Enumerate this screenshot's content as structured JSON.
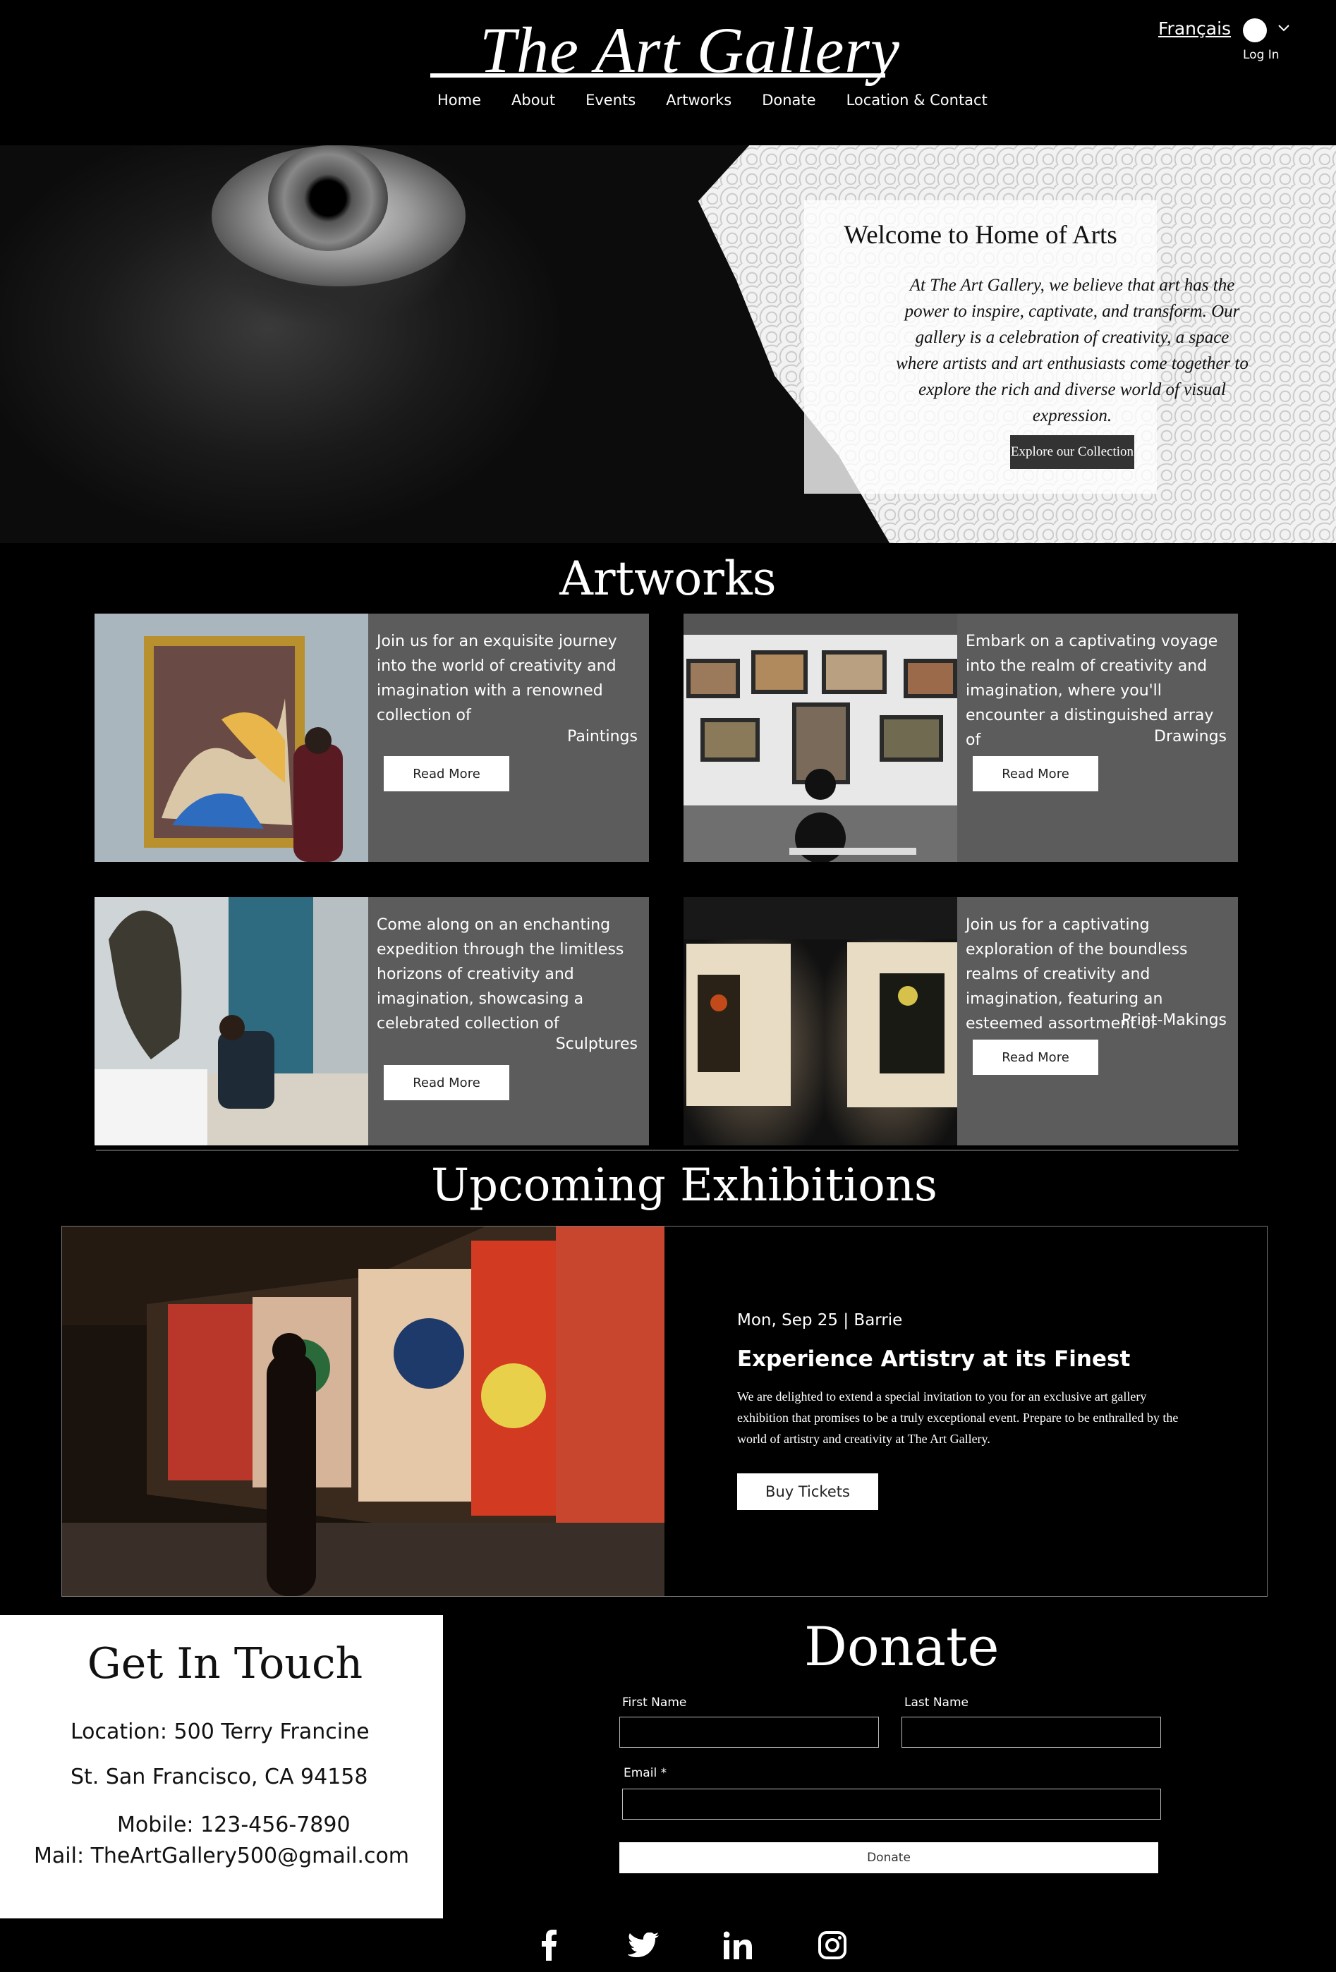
{
  "header": {
    "site_title": "The Art Gallery",
    "nav": [
      "Home",
      "About",
      "Events",
      "Artworks",
      "Donate",
      "Location & Contact"
    ],
    "language_link": "Français",
    "login_label": "Log In"
  },
  "hero": {
    "heading": "Welcome to Home of Arts",
    "text": "At The Art Gallery, we believe that art has the power to inspire, captivate, and transform. Our gallery is a celebration of creativity, a space where artists and art enthusiasts come together to explore the rich and diverse world of visual expression.",
    "cta_label": "Explore our Collection"
  },
  "artworks": {
    "heading": "Artworks",
    "cards": [
      {
        "text": "Join us for an exquisite journey into the world of creativity and imagination with a renowned collection of",
        "category": "Paintings",
        "button_label": "Read More"
      },
      {
        "text": "Embark on a captivating voyage into the realm of creativity and imagination, where you'll encounter a distinguished array of",
        "category": "Drawings",
        "button_label": "Read More"
      },
      {
        "text": "Come along on an enchanting expedition through the limitless horizons of creativity and imagination, showcasing a celebrated collection of",
        "category": "Sculptures",
        "button_label": "Read More"
      },
      {
        "text": "Join us for a captivating exploration of the boundless realms of creativity and imagination, featuring an esteemed assortment of",
        "category": "Print-Makings",
        "button_label": "Read More"
      }
    ]
  },
  "exhibitions": {
    "heading": "Upcoming Exhibitions",
    "event": {
      "date_location": "Mon, Sep 25  |  Barrie",
      "title": "Experience Artistry at its Finest",
      "description": "We are delighted to extend a special invitation to you for an exclusive art gallery exhibition that promises to be a truly exceptional event. Prepare to be enthralled by the world of artistry and creativity at The Art Gallery.",
      "button_label": "Buy Tickets"
    }
  },
  "contact": {
    "heading": "Get In Touch",
    "location_line1": "Location: 500 Terry Francine",
    "location_line2": "St. San Francisco, CA 94158",
    "mobile": "Mobile: 123-456-7890",
    "mail": "Mail: TheArtGallery500@gmail.com"
  },
  "donate": {
    "heading": "Donate",
    "first_name_label": "First Name",
    "last_name_label": "Last Name",
    "email_label": "Email *",
    "button_label": "Donate"
  },
  "social": [
    "facebook-icon",
    "twitter-icon",
    "linkedin-icon",
    "instagram-icon"
  ]
}
